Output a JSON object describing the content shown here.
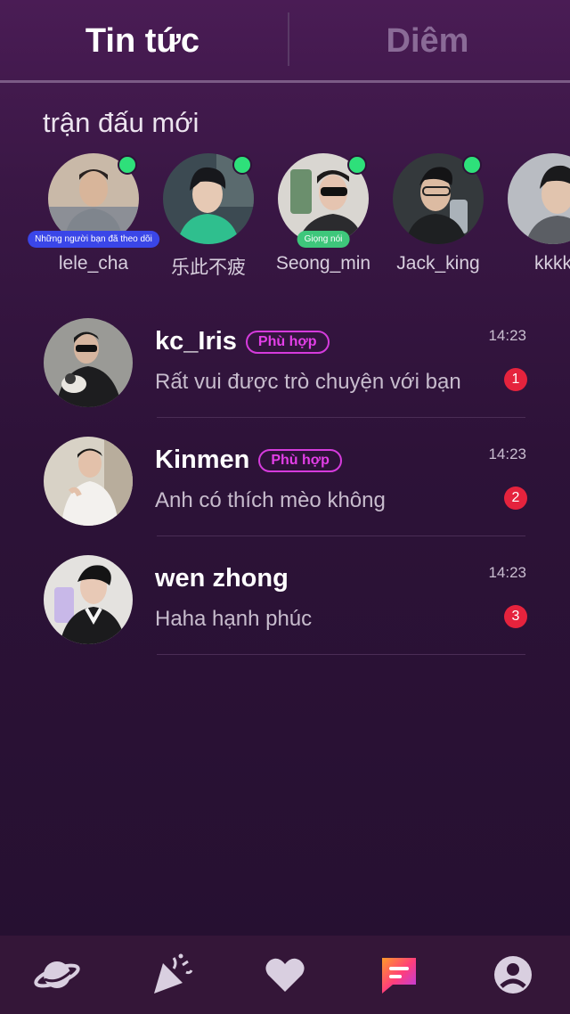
{
  "header": {
    "tabs": [
      {
        "label": "Tin tức",
        "active": true
      },
      {
        "label": "Diêm",
        "active": false
      }
    ]
  },
  "new_matches": {
    "title": "trận đấu mới",
    "items": [
      {
        "name": "lele_cha",
        "online": true,
        "tag": "Những người bạn đã theo dõi"
      },
      {
        "name": "乐此不疲",
        "online": true,
        "tag": ""
      },
      {
        "name": "Seong_min",
        "online": true,
        "tag": "Giọng nói"
      },
      {
        "name": "Jack_king",
        "online": true,
        "tag": ""
      },
      {
        "name": "kkkk",
        "online": false,
        "tag": ""
      }
    ]
  },
  "conversations": [
    {
      "name": "kc_Iris",
      "badge": "Phù hợp",
      "time": "14:23",
      "message": "Rất vui được trò chuyện với bạn",
      "unread": "1"
    },
    {
      "name": "Kinmen",
      "badge": "Phù hợp",
      "time": "14:23",
      "message": "Anh có thích mèo không",
      "unread": "2"
    },
    {
      "name": "wen zhong",
      "badge": "",
      "time": "14:23",
      "message": "Haha hạnh phúc",
      "unread": "3"
    }
  ],
  "bottom_nav": {
    "items": [
      {
        "icon": "planet-icon",
        "active": false
      },
      {
        "icon": "party-popper-icon",
        "active": false
      },
      {
        "icon": "heart-icon",
        "active": false
      },
      {
        "icon": "chat-icon",
        "active": true
      },
      {
        "icon": "profile-icon",
        "active": false
      }
    ]
  },
  "colors": {
    "accent": "#d53bdc",
    "online": "#2ee07a",
    "unread": "#e5233d"
  }
}
